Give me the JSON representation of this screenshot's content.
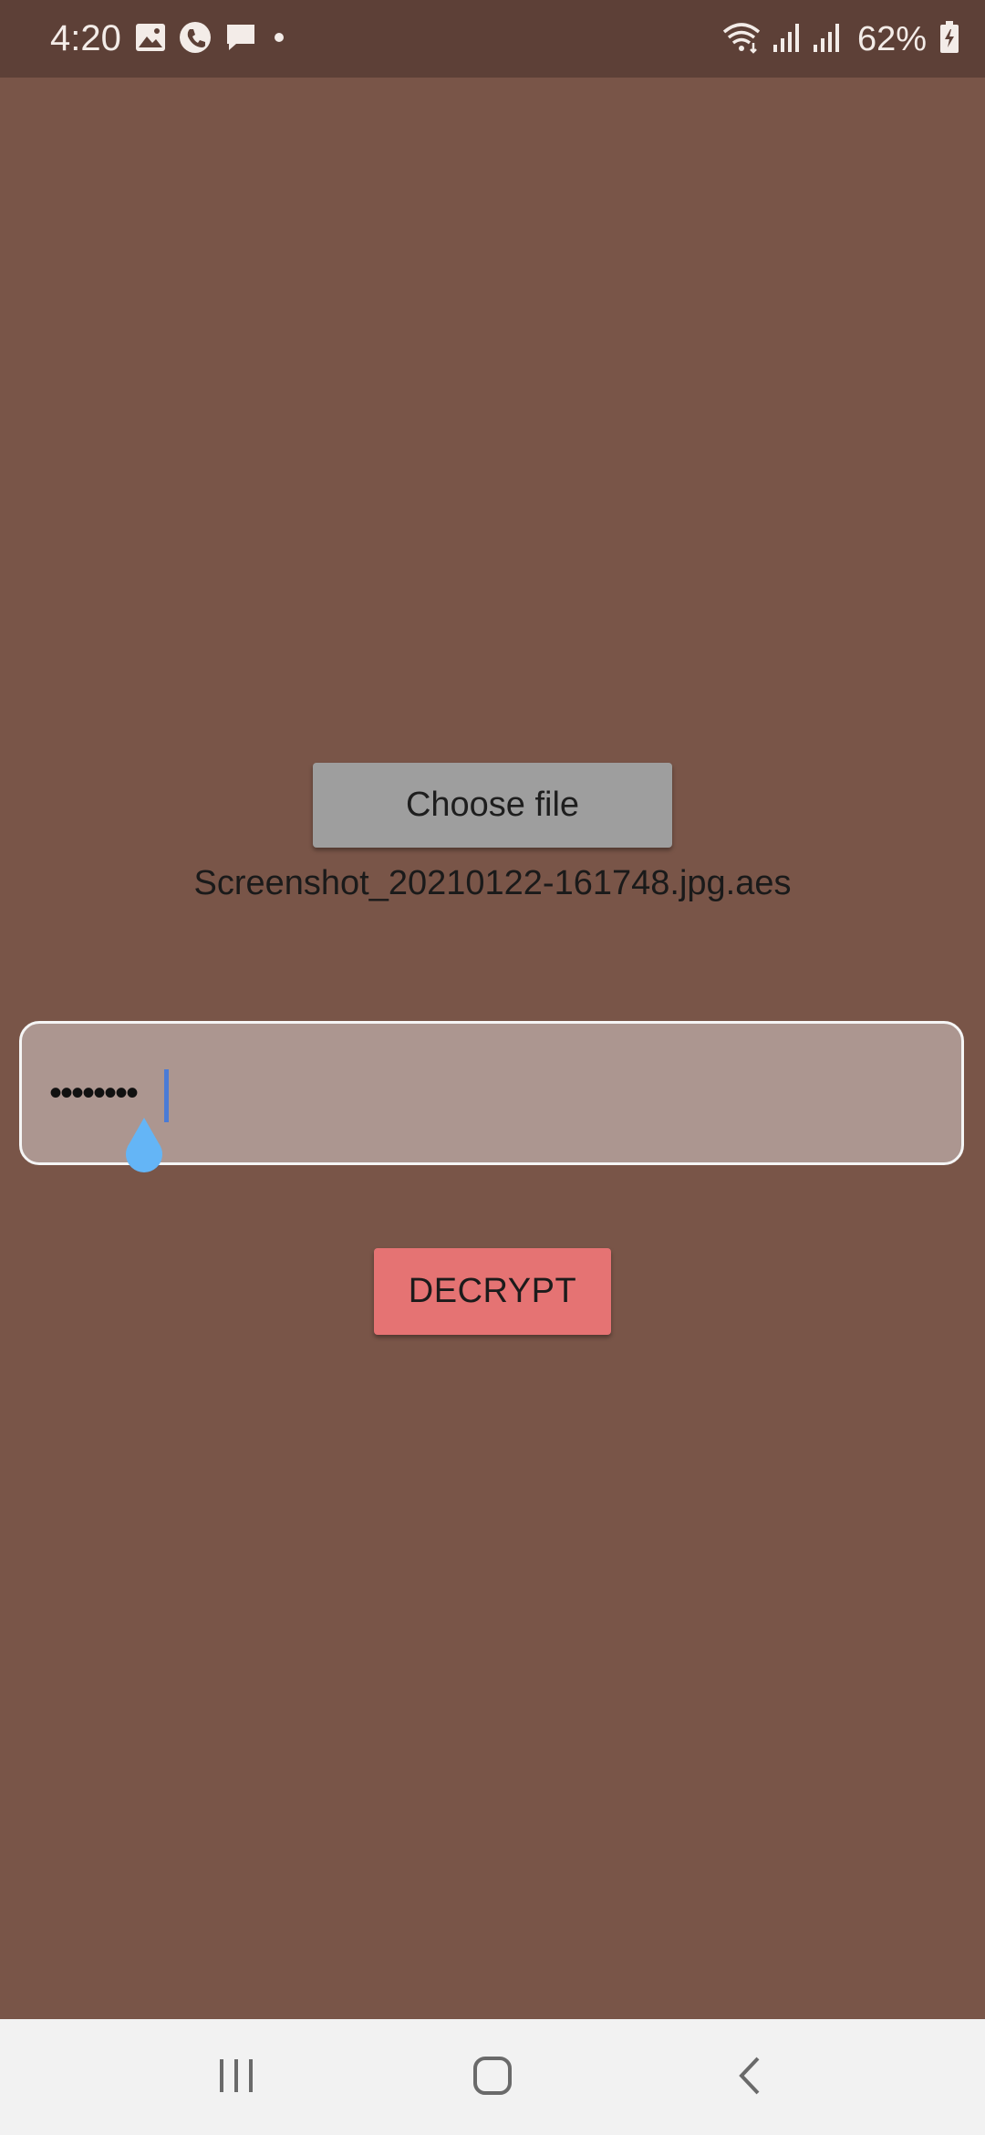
{
  "status_bar": {
    "time": "4:20",
    "battery": "62%",
    "left_icons": [
      "gallery-icon",
      "phone-call-icon",
      "message-icon",
      "dot-icon"
    ],
    "right_icons": [
      "wifi-icon",
      "signal-icon",
      "signal-icon",
      "battery-charging-icon"
    ]
  },
  "main": {
    "choose_file_label": "Choose file",
    "file_name": "Screenshot_20210122-161748.jpg.aes",
    "password_value": "••••••••",
    "decrypt_label": "DECRYPT"
  },
  "nav_bar": {
    "items": [
      "recent-apps-icon",
      "home-icon",
      "back-icon"
    ]
  },
  "colors": {
    "background": "#795548",
    "status_bar": "#5D4037",
    "choose_button": "#9E9E9E",
    "decrypt_button": "#E57373",
    "password_field": "#AC9690",
    "cursor": "#64B5F6"
  }
}
